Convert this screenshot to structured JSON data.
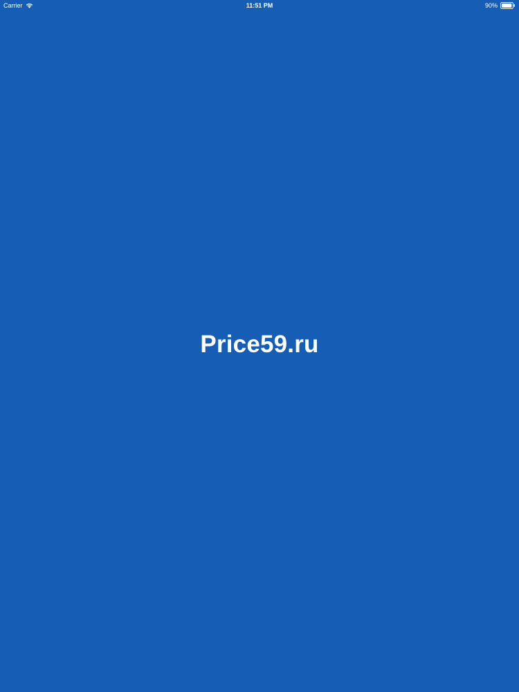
{
  "status_bar": {
    "carrier": "Carrier",
    "time": "11:51 PM",
    "battery": "90%",
    "wifi_icon": "wifi-icon",
    "battery_icon": "battery-icon",
    "battery_level": 0.9
  },
  "splash": {
    "title": "Price59.ru"
  },
  "colors": {
    "background": "#155db5",
    "text": "#ffffff"
  }
}
